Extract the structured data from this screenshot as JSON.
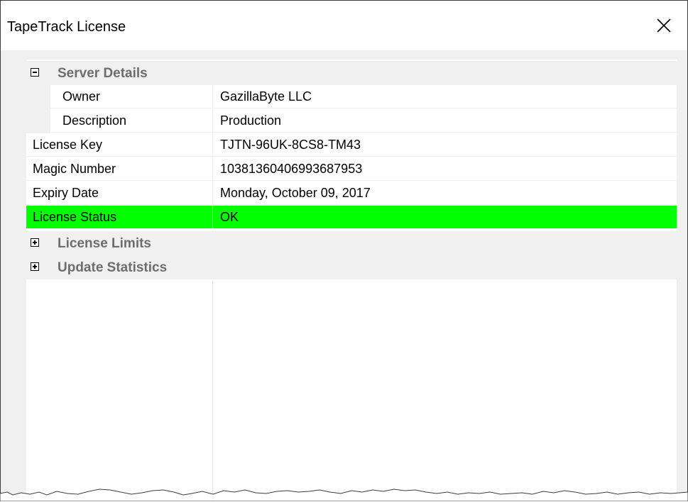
{
  "window": {
    "title": "TapeTrack License"
  },
  "colors": {
    "status_ok": "#00ff00",
    "category_text": "#6d6d6d"
  },
  "icons": {
    "close": "close-icon",
    "collapse": "minus-box-icon",
    "expand": "plus-box-icon"
  },
  "properties": {
    "server_details": {
      "label": "Server Details",
      "expanded": true,
      "owner": {
        "name": "Owner",
        "value": "GazillaByte LLC"
      },
      "description": {
        "name": "Description",
        "value": "Production"
      }
    },
    "license_key": {
      "name": "License Key",
      "value": "TJTN-96UK-8CS8-TM43"
    },
    "magic_number": {
      "name": "Magic Number",
      "value": "10381360406993687953"
    },
    "expiry_date": {
      "name": "Expiry Date",
      "value": "Monday, October 09, 2017"
    },
    "license_status": {
      "name": "License Status",
      "value": "OK"
    },
    "license_limits": {
      "label": "License Limits",
      "expanded": false
    },
    "update_statistics": {
      "label": "Update Statistics",
      "expanded": false
    }
  }
}
